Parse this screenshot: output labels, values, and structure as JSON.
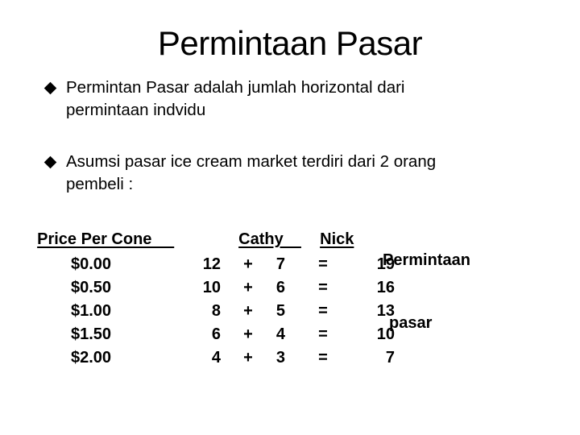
{
  "slide": {
    "title": "Permintaan Pasar",
    "bullets": [
      {
        "icon": "diamond-bullet-icon",
        "line1": "Permintan Pasar  adalah jumlah horizontal  dari",
        "line2": "permintaan indvidu"
      },
      {
        "icon": "diamond-bullet-icon",
        "line1": "Asumsi  pasar ice cream market  terdiri dari 2 orang",
        "line2": "pembeli :"
      }
    ]
  },
  "table": {
    "headers": {
      "price": "Price Per Cone     ",
      "cathy": "Cathy    ",
      "nick": "Nick",
      "market_line1": "Permintaan",
      "market_line2": "pasar"
    },
    "rows": [
      {
        "price": "$0.00",
        "cathy": "12",
        "plus": "+",
        "nick": "7",
        "equals": "=",
        "total": "19"
      },
      {
        "price": "$0.50",
        "cathy": "10",
        "plus": "+",
        "nick": "6",
        "equals": "=",
        "total": "16"
      },
      {
        "price": "$1.00",
        "cathy": "8",
        "plus": "+",
        "nick": "5",
        "equals": "=",
        "total": "13"
      },
      {
        "price": "$1.50",
        "cathy": "6",
        "plus": "+",
        "nick": "4",
        "equals": "=",
        "total": "10"
      },
      {
        "price": "$2.00",
        "cathy": "4",
        "plus": "+",
        "nick": "3",
        "equals": "=",
        "total": "7"
      }
    ]
  }
}
